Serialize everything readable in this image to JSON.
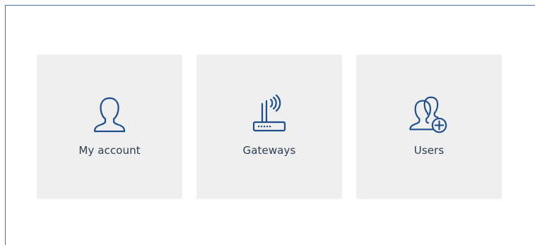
{
  "tiles": [
    {
      "label": "My account",
      "icon": "user-icon"
    },
    {
      "label": "Gateways",
      "icon": "gateway-router-icon"
    },
    {
      "label": "Users",
      "icon": "users-add-icon"
    }
  ],
  "colors": {
    "icon_stroke": "#1f4e8c",
    "tile_bg": "#efefef",
    "label_text": "#2d3e52",
    "frame_border": "#4a6fa5"
  }
}
